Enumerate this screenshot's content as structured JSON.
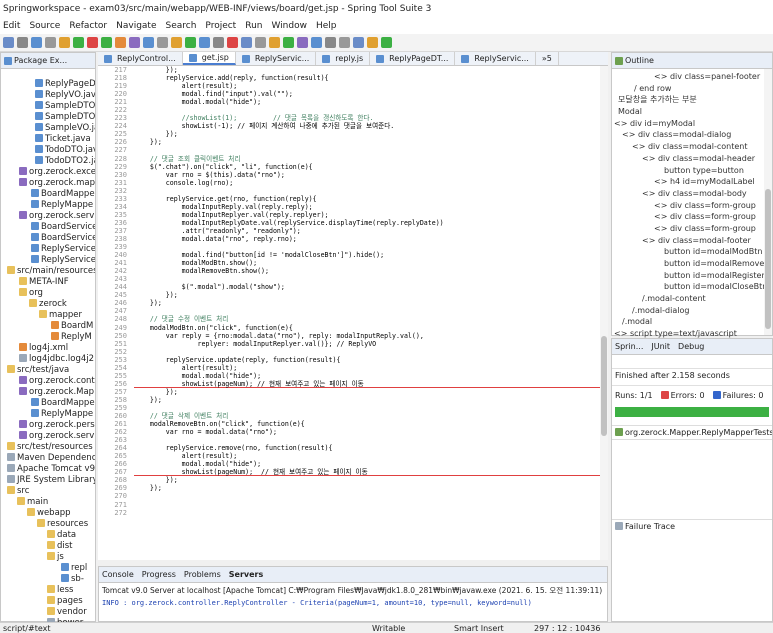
{
  "window_title": "Springworkspace - exam03/src/main/webapp/WEB-INF/views/board/get.jsp - Spring Tool Suite 3",
  "menu": [
    "Edit",
    "Source",
    "Refactor",
    "Navigate",
    "Search",
    "Project",
    "Run",
    "Window",
    "Help"
  ],
  "package_explorer": {
    "tab": "Package Ex...",
    "items": [
      {
        "label": "ReplyPageDT",
        "icon": "j",
        "indent": 34
      },
      {
        "label": "ReplyVO.java",
        "icon": "j",
        "indent": 34
      },
      {
        "label": "SampleDTO.",
        "icon": "j",
        "indent": 34
      },
      {
        "label": "SampleDTOL",
        "icon": "j",
        "indent": 34
      },
      {
        "label": "SampleVO.ja",
        "icon": "j",
        "indent": 34
      },
      {
        "label": "Ticket.java",
        "icon": "j",
        "indent": 34
      },
      {
        "label": "TodoDTO.jav",
        "icon": "j",
        "indent": 34
      },
      {
        "label": "TodoDTO2.ja",
        "icon": "j",
        "indent": 34
      },
      {
        "label": "org.zerock.exce",
        "icon": "p",
        "indent": 18
      },
      {
        "label": "org.zerock.map",
        "icon": "p",
        "indent": 18
      },
      {
        "label": "BoardMappe",
        "icon": "j",
        "indent": 30
      },
      {
        "label": "ReplyMappe",
        "icon": "j",
        "indent": 30
      },
      {
        "label": "org.zerock.servi",
        "icon": "p",
        "indent": 18
      },
      {
        "label": "BoardService",
        "icon": "j",
        "indent": 30
      },
      {
        "label": "BoardService",
        "icon": "j",
        "indent": 30
      },
      {
        "label": "ReplyService",
        "icon": "j",
        "indent": 30
      },
      {
        "label": "ReplyService",
        "icon": "j",
        "indent": 30
      },
      {
        "label": "src/main/resources",
        "icon": "f",
        "indent": 6
      },
      {
        "label": "META-INF",
        "icon": "f",
        "indent": 18
      },
      {
        "label": "org",
        "icon": "f",
        "indent": 18
      },
      {
        "label": "zerock",
        "icon": "f",
        "indent": 28
      },
      {
        "label": "mapper",
        "icon": "f",
        "indent": 38
      },
      {
        "label": "BoardM",
        "icon": "x",
        "indent": 50
      },
      {
        "label": "ReplyM",
        "icon": "x",
        "indent": 50
      },
      {
        "label": "log4j.xml",
        "icon": "x",
        "indent": 18
      },
      {
        "label": "log4jdbc.log4j2",
        "icon": "b",
        "indent": 18
      },
      {
        "label": "src/test/java",
        "icon": "f",
        "indent": 6
      },
      {
        "label": "org.zerock.cont",
        "icon": "p",
        "indent": 18
      },
      {
        "label": "org.zerock.Map",
        "icon": "p",
        "indent": 18
      },
      {
        "label": "BoardMappe",
        "icon": "j",
        "indent": 30
      },
      {
        "label": "ReplyMappe",
        "icon": "j",
        "indent": 30
      },
      {
        "label": "org.zerock.persi",
        "icon": "p",
        "indent": 18
      },
      {
        "label": "org.zerock.servi",
        "icon": "p",
        "indent": 18
      },
      {
        "label": "src/test/resources",
        "icon": "f",
        "indent": 6
      },
      {
        "label": "Maven Dependenc",
        "icon": "b",
        "indent": 6
      },
      {
        "label": "Apache Tomcat v9",
        "icon": "b",
        "indent": 6
      },
      {
        "label": "JRE System Library",
        "icon": "b",
        "indent": 6
      },
      {
        "label": "src",
        "icon": "f",
        "indent": 6
      },
      {
        "label": "main",
        "icon": "f",
        "indent": 16
      },
      {
        "label": "webapp",
        "icon": "f",
        "indent": 26
      },
      {
        "label": "resources",
        "icon": "f",
        "indent": 36
      },
      {
        "label": "data",
        "icon": "f",
        "indent": 46
      },
      {
        "label": "dist",
        "icon": "f",
        "indent": 46
      },
      {
        "label": "js",
        "icon": "f",
        "indent": 46
      },
      {
        "label": "repl",
        "icon": "j",
        "indent": 60
      },
      {
        "label": "sb-",
        "icon": "j",
        "indent": 60
      },
      {
        "label": "less",
        "icon": "f",
        "indent": 46
      },
      {
        "label": "pages",
        "icon": "f",
        "indent": 46
      },
      {
        "label": "vendor",
        "icon": "f",
        "indent": 46
      },
      {
        "label": "bower.",
        "icon": "b",
        "indent": 46
      }
    ]
  },
  "editor_tabs": [
    {
      "label": "ReplyControl..."
    },
    {
      "label": "get.jsp",
      "active": true
    },
    {
      "label": "ReplyServic..."
    },
    {
      "label": "reply.js"
    },
    {
      "label": "ReplyPageDT..."
    },
    {
      "label": "ReplyServic..."
    },
    {
      "label": "»5"
    }
  ],
  "line_start": 217,
  "code_lines": [
    "        });",
    "        replyService.add(reply, function(result){",
    "            alert(result);",
    "            modal.find(\"input\").val(\"\");",
    "            modal.modal(\"hide\");",
    "",
    "            //showList(1);         // 댓글 목록을 갱신하도록 한다.",
    "            showList(-1); // 페이지 계산하여 나중에 추가된 댓글을 보여준다.",
    "        });",
    "    });",
    "",
    "    // 댓글 조회 클릭이벤트 처리",
    "    $(\".chat\").on(\"click\", \"li\", function(e){",
    "        var rno = $(this).data(\"rno\");",
    "        console.log(rno);",
    "",
    "        replyService.get(rno, function(reply){",
    "            modalInputReply.val(reply.reply);",
    "            modalInputReplyer.val(reply.replyer);",
    "            modalInputReplyDate.val(replyService.displayTime(reply.replyDate))",
    "            .attr(\"readonly\", \"readonly\");",
    "            modal.data(\"rno\", reply.rno);",
    "",
    "            modal.find(\"button[id != 'modalCloseBtn']\").hide();",
    "            modalModBtn.show();",
    "            modalRemoveBtn.show();",
    "",
    "            $(\".modal\").modal(\"show\");",
    "        });",
    "    });",
    "",
    "    // 댓글 수정 이벤트 처리",
    "    modalModBtn.on(\"click\", function(e){",
    "        var reply = {rno:modal.data(\"rno\"), reply: modalInputReply.val(),",
    "                replyer: modalInputReplyer.val()}; // ReplyVO",
    "",
    "        replyService.update(reply, function(result){",
    "            alert(result);",
    "            modal.modal(\"hide\");",
    "            showList(pageNum); // 현재 보여주고 있는 페이지 이동",
    "        });",
    "    });",
    "",
    "    // 댓글 삭제 이벤트 처리",
    "    modalRemoveBtn.on(\"click\", function(e){",
    "        var rno = modal.data(\"rno\");",
    "",
    "        replyService.remove(rno, function(result){",
    "            alert(result);",
    "            modal.modal(\"hide\");",
    "            showList(pageNum);  // 현재 보여주고 있는 페이지 이동",
    "        });",
    "    });",
    "",
    "",
    ""
  ],
  "outline": {
    "tab": "Outline",
    "items": [
      {
        "text": "<> div class=panel-footer",
        "indent": 42
      },
      {
        "text": "/ end row",
        "indent": 22
      },
      {
        "text": "모달창을 추가하는 부분",
        "indent": 6
      },
      {
        "text": "Modal",
        "indent": 6
      },
      {
        "text": "<> div id=myModal",
        "indent": 2
      },
      {
        "text": "<> div class=modal-dialog",
        "indent": 10
      },
      {
        "text": "<> div class=modal-content",
        "indent": 20
      },
      {
        "text": "<> div class=modal-header",
        "indent": 30
      },
      {
        "text": "button type=button",
        "indent": 52
      },
      {
        "text": "<> h4 id=myModalLabel",
        "indent": 42
      },
      {
        "text": "<> div class=modal-body",
        "indent": 30
      },
      {
        "text": "<> div class=form-group",
        "indent": 42
      },
      {
        "text": "<> div class=form-group",
        "indent": 42
      },
      {
        "text": "<> div class=form-group",
        "indent": 42
      },
      {
        "text": "<> div class=modal-footer",
        "indent": 30
      },
      {
        "text": "button id=modalModBtn",
        "indent": 52
      },
      {
        "text": "button id=modalRemoveB",
        "indent": 52
      },
      {
        "text": "button id=modalRegisterB",
        "indent": 52
      },
      {
        "text": "button id=modalCloseBtn",
        "indent": 52
      },
      {
        "text": "/.modal-content",
        "indent": 30
      },
      {
        "text": "/.modal-dialog",
        "indent": 20
      },
      {
        "text": "/.modal",
        "indent": 10
      },
      {
        "text": "<> script type=text/javascript",
        "indent": 2
      },
      {
        "text": "<> script type=text/javascript",
        "indent": 2
      }
    ]
  },
  "junit": {
    "tabs": [
      "Sprin...",
      "JUnit",
      "Debug"
    ],
    "finished": "Finished after 2.158 seconds",
    "runs_label": "Runs:",
    "runs": "1/1",
    "errors_label": "Errors:",
    "errors": "0",
    "failures_label": "Failures:",
    "failures": "0",
    "test": "org.zerock.Mapper.ReplyMapperTests [Run",
    "failure_trace": "Failure Trace"
  },
  "console": {
    "tabs": [
      "Console",
      "Progress",
      "Problems",
      "Servers"
    ],
    "server_line": "Tomcat v9.0 Server at localhost [Apache Tomcat] C:₩Program Files₩Java₩jdk1.8.0_281₩bin₩javaw.exe  (2021. 6. 15. 오전 11:39:11)",
    "output": "INFO : org.zerock.controller.ReplyController - Criteria(pageNum=1, amount=10, type=null, keyword=null)"
  },
  "status": {
    "left": "script/#text",
    "writable": "Writable",
    "mode": "Smart Insert",
    "position": "297 : 12 : 10436"
  },
  "colors": {
    "accent": "#4a7dd0",
    "junit_bar": "#3cb043"
  }
}
